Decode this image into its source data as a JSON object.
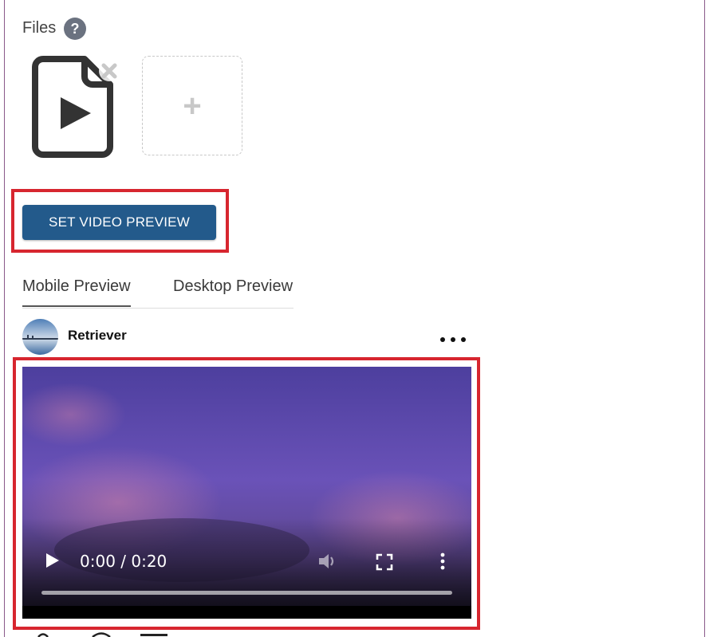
{
  "files": {
    "label": "Files",
    "help_icon": "question-mark-icon",
    "file_icon": "video-file-icon",
    "remove_icon": "close-icon",
    "add_icon": "plus-icon",
    "add_label": "+"
  },
  "actions": {
    "set_video_preview_label": "SET VIDEO PREVIEW"
  },
  "tabs": [
    {
      "label": "Mobile Preview",
      "active": true
    },
    {
      "label": "Desktop Preview",
      "active": false
    }
  ],
  "post": {
    "author": "Retriever",
    "more_icon": "more-horizontal-icon"
  },
  "video": {
    "time": "0:00 / 0:20",
    "progress": 0,
    "icons": [
      "play-icon",
      "volume-icon",
      "fullscreen-icon",
      "more-vertical-icon"
    ]
  },
  "colors": {
    "primary_button": "#235a8b",
    "highlight": "#d7262f",
    "help_icon_bg": "#6b7280"
  }
}
